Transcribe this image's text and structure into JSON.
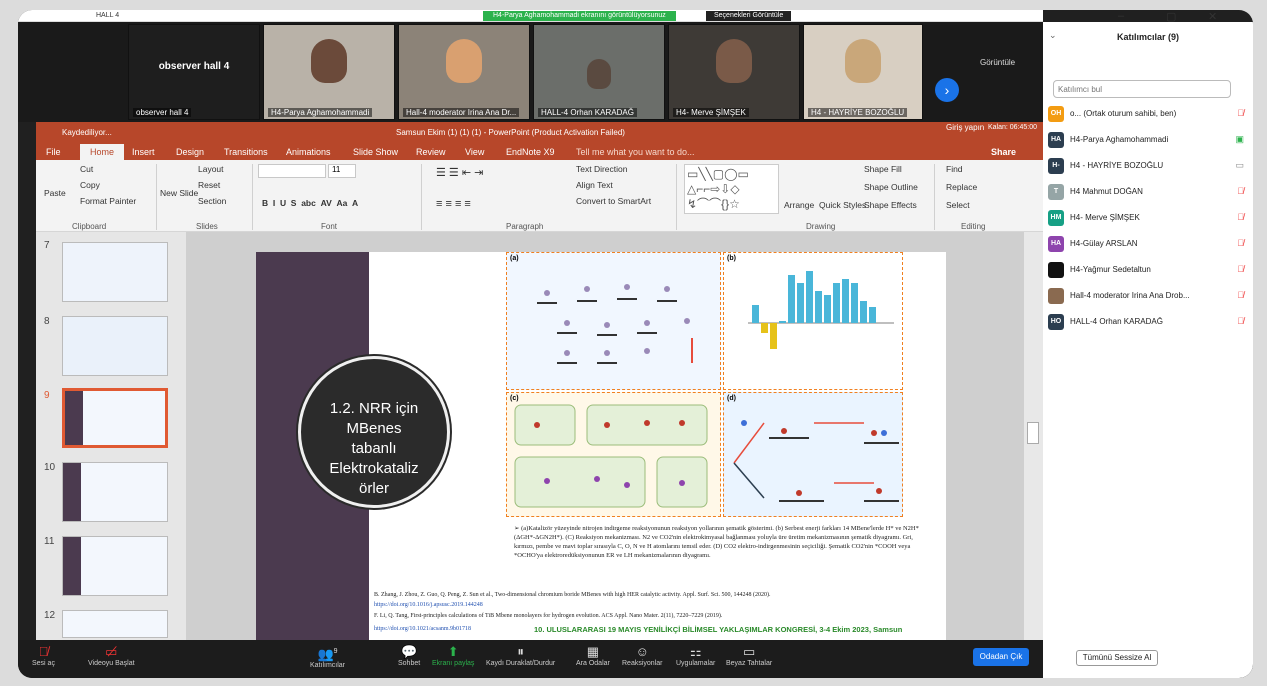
{
  "window": {
    "title": "HALL 4",
    "controls": [
      "–",
      "▢",
      "✕"
    ]
  },
  "share_banner": "H4-Parya Aghamohammadi ekranını görüntülüyorsunuz",
  "view_options": "Seçenekleri Görüntüle",
  "video_strip": {
    "view_label": "Görüntüle",
    "tiles": [
      {
        "name": "observer hall 4",
        "big": "observer hall 4"
      },
      {
        "name": "H4-Parya Aghamohammadi"
      },
      {
        "name": "Hall-4 moderator Irina Ana Dr..."
      },
      {
        "name": "HALL-4 Orhan KARADAĞ"
      },
      {
        "name": "H4- Merve ŞİMŞEK"
      },
      {
        "name": "H4 - HAYRİYE BOZOĞLU"
      }
    ]
  },
  "ppt": {
    "status": "Kaydediliyor...",
    "title": "Samsun Ekim (1) (1) (1) - PowerPoint (Product Activation Failed)",
    "signin": "Giriş yapın",
    "timer": "Kalan: 06:45:00",
    "tabs": [
      "File",
      "Home",
      "Insert",
      "Design",
      "Transitions",
      "Animations",
      "Slide Show",
      "Review",
      "View",
      "EndNote X9"
    ],
    "tell_me": "Tell me what you want to do...",
    "share": "Share",
    "ribbon": {
      "paste": "Paste",
      "cut": "Cut",
      "copy": "Copy",
      "format_painter": "Format Painter",
      "clipboard": "Clipboard",
      "new_slide": "New Slide",
      "layout": "Layout",
      "reset": "Reset",
      "section": "Section",
      "slides": "Slides",
      "font_size": "11",
      "font": "Font",
      "text_direction": "Text Direction",
      "align_text": "Align Text",
      "convert_smartart": "Convert to SmartArt",
      "paragraph": "Paragraph",
      "arrange": "Arrange",
      "quick_styles": "Quick Styles",
      "shape_fill": "Shape Fill",
      "shape_outline": "Shape Outline",
      "shape_effects": "Shape Effects",
      "drawing": "Drawing",
      "find": "Find",
      "replace": "Replace",
      "select": "Select",
      "editing": "Editing"
    },
    "slide_numbers": [
      "7",
      "8",
      "9",
      "10",
      "11",
      "12"
    ],
    "slide": {
      "circle_lines": [
        "1.2. NRR için",
        "MBenes",
        "tabanlı",
        "Elektrokataliz",
        "örler"
      ],
      "fig_labels": {
        "a": "(a)",
        "b": "(b)",
        "c": "(c)",
        "d": "(d)"
      },
      "caption": "➢ (a)Katalizör yüzeyinde nitrojen indirgeme reaksiyonunun reaksiyon yollarının şematik gösterimi. (b) Serbest enerji farkları 14 MBene'lerde H* ve N2H*(ΔGH*-ΔGN2H*). (C) Reaksiyon mekanizması. N2 ve CO2'nin elektrokimyasal bağlanması yoluyla üre üretim mekanizmasının şematik diyagramı. Gri, kırmızı, pembe ve mavi toplar sırasıyla C, O, N ve H atomlarını temsil eder. (D) CO2 elektro-indirgenmesinin seçiciliği. Şematik CO2'nin *COOH veya *OCHO'ya elektroredüksiyonunun ER ve LH mekanizmalarının diyagramı.",
      "refs": [
        "B. Zhang, J. Zhou, Z. Guo, Q. Peng, Z. Sun et al., Two-dimensional chromium boride MBenes with high HER catalytic activity. Appl. Surf. Sci. 500, 144248 (2020).",
        "https://doi.org/10.1016/j.apsusc.2019.144248",
        "F. Li, Q. Tang, First-principles calculations of TiB Mbene monolayers for hydrogen evolution. ACS Appl. Nano Mater. 2(11), 7220–7229 (2019).",
        "https://doi.org/10.1021/acsanm.9b01718"
      ],
      "congress": "10. ULUSLARARASI 19 MAYIS YENİLİKÇİ BİLİMSEL YAKLAŞIMLAR KONGRESİ, 3-4 Ekim 2023, Samsun"
    }
  },
  "participants": {
    "header": "Katılımcılar (9)",
    "search_placeholder": "Katılımcı bul",
    "list": [
      {
        "initials": "OH",
        "name": "o... (Ortak oturum sahibi, ben)",
        "color": "#f39c12"
      },
      {
        "initials": "HA",
        "name": "H4-Parya Aghamohammadi",
        "color": "#2c3e50"
      },
      {
        "initials": "H-",
        "name": "H4 - HAYRİYE BOZOĞLU",
        "color": "#2c3e50"
      },
      {
        "initials": "T",
        "name": "H4 Mahmut DOĞAN",
        "color": "#95a5a6"
      },
      {
        "initials": "HM",
        "name": "H4- Merve ŞİMŞEK",
        "color": "#16a085"
      },
      {
        "initials": "HA",
        "name": "H4-Gülay ARSLAN",
        "color": "#8e44ad"
      },
      {
        "initials": "",
        "name": "H4-Yağmur Sedetaltun",
        "color": "#111111"
      },
      {
        "initials": "",
        "name": "Hall-4 moderator Irina Ana Drob...",
        "color": "#8a6a50"
      },
      {
        "initials": "HO",
        "name": "HALL-4 Orhan KARADAĞ",
        "color": "#2c3e50"
      }
    ],
    "mute_all": "Tümünü Sessize Al"
  },
  "bottom_bar": {
    "unmute": "Sesi aç",
    "start_video": "Videoyu Başlat",
    "participants": "Katılımcılar",
    "participants_count": "9",
    "chat": "Sohbet",
    "share": "Ekranı paylaş",
    "pause_record": "Kaydı Duraklat/Durdur",
    "breakout": "Ara Odalar",
    "reactions": "Reaksiyonlar",
    "apps": "Uygulamalar",
    "whiteboards": "Beyaz Tahtalar",
    "leave": "Odadan Çık"
  }
}
